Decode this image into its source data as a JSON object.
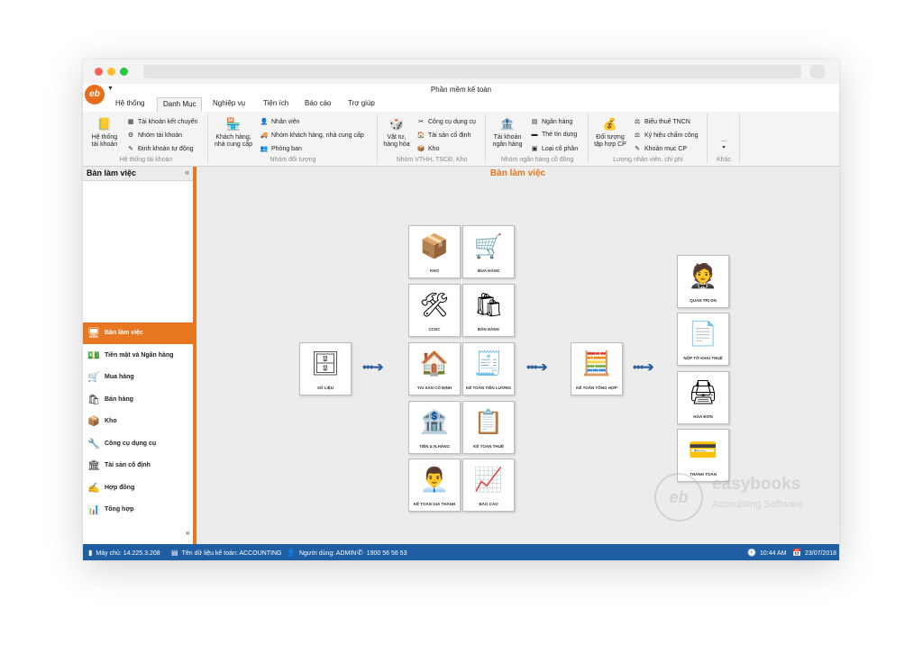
{
  "window": {
    "title": "Phần mềm kế toán",
    "logo_text": "eb"
  },
  "menu": [
    {
      "label": "Hệ thống",
      "active": false
    },
    {
      "label": "Danh Mục",
      "active": true
    },
    {
      "label": "Nghiệp vụ",
      "active": false
    },
    {
      "label": "Tiện ích",
      "active": false
    },
    {
      "label": "Báo cáo",
      "active": false
    },
    {
      "label": "Trợ giúp",
      "active": false
    }
  ],
  "ribbon": {
    "groups": [
      {
        "label": "Hệ thống tài khoản",
        "big": [
          {
            "line1": "Hệ thống",
            "line2": "tài khoản",
            "icon": "account-system-icon"
          }
        ],
        "small": [
          {
            "label": "Tài khoản kết chuyển",
            "icon": "transfer-account-icon"
          },
          {
            "label": "Nhóm tài khoản",
            "icon": "account-group-icon"
          },
          {
            "label": "Định khoản tự động",
            "icon": "auto-entry-icon"
          }
        ]
      },
      {
        "label": "Nhóm đối tượng",
        "big": [
          {
            "line1": "Khách hàng,",
            "line2": "nhà cung cấp",
            "icon": "customer-supplier-icon"
          }
        ],
        "small": [
          {
            "label": "Nhân viên",
            "icon": "employee-icon"
          },
          {
            "label": "Nhóm khách hàng, nhà cung cấp",
            "icon": "customer-group-icon"
          },
          {
            "label": "Phòng ban",
            "icon": "department-icon"
          }
        ]
      },
      {
        "label": "Nhóm VTHH, TSCĐ, Kho",
        "big": [
          {
            "line1": "Vật tư,",
            "line2": "hàng hóa",
            "icon": "goods-icon"
          }
        ],
        "small": [
          {
            "label": "Công cụ dụng cụ",
            "icon": "tools-icon"
          },
          {
            "label": "Tài sản cố định",
            "icon": "fixed-asset-icon"
          },
          {
            "label": "Kho",
            "icon": "warehouse-icon"
          }
        ]
      },
      {
        "label": "Nhóm ngân hàng cổ đông",
        "big": [
          {
            "line1": "Tài khoản",
            "line2": "ngân hàng",
            "icon": "bank-account-icon"
          }
        ],
        "small": [
          {
            "label": "Ngân hàng",
            "icon": "bank-icon"
          },
          {
            "label": "Thẻ tín dụng",
            "icon": "credit-card-icon"
          },
          {
            "label": "Loại cổ phần",
            "icon": "share-type-icon"
          }
        ]
      },
      {
        "label": "Lương nhân viên, chi phí",
        "big": [
          {
            "line1": "Đối tượng",
            "line2": "tập hợp CP",
            "icon": "cost-object-icon"
          }
        ],
        "small": [
          {
            "label": "Biểu thuế TNCN",
            "icon": "tax-table-icon"
          },
          {
            "label": "Ký hiệu chấm công",
            "icon": "timesheet-icon"
          },
          {
            "label": "Khoản mục CP",
            "icon": "cost-item-icon"
          }
        ]
      },
      {
        "label": "Khác",
        "big": [
          {
            "line1": "...",
            "line2": "",
            "icon": "more-icon"
          }
        ],
        "small": []
      }
    ]
  },
  "sidebar": {
    "title": "Bàn làm việc",
    "items": [
      {
        "label": "Bàn làm việc",
        "active": true,
        "icon": "desktop-icon"
      },
      {
        "label": "Tiền mặt và Ngân hàng",
        "active": false,
        "icon": "cash-bank-icon"
      },
      {
        "label": "Mua hàng",
        "active": false,
        "icon": "purchase-icon"
      },
      {
        "label": "Bán hàng",
        "active": false,
        "icon": "sales-icon"
      },
      {
        "label": "Kho",
        "active": false,
        "icon": "warehouse-icon"
      },
      {
        "label": "Công cụ dụng cụ",
        "active": false,
        "icon": "tools-icon"
      },
      {
        "label": "Tài sản cố định",
        "active": false,
        "icon": "fixed-asset-icon"
      },
      {
        "label": "Hợp đồng",
        "active": false,
        "icon": "contract-icon"
      },
      {
        "label": "Tổng hợp",
        "active": false,
        "icon": "summary-icon"
      }
    ]
  },
  "workspace": {
    "title": "Bàn làm việc",
    "tiles": {
      "so_lieu": "SỐ LIỆU",
      "kho": "KHO",
      "mua_hang": "MUA HÀNG",
      "ccdc": "CCDC",
      "ban_hang": "BÁN HÀNG",
      "tai_san": "TÀI SẢN CỐ ĐỊNH",
      "tien_luong": "KẾ TOÁN TIỀN LƯƠNG",
      "tien_ngan_hang": "TIỀN & N.HÀNG",
      "ke_toan_thue": "KẾ TOÁN THUẾ",
      "gia_thanh": "KẾ TOÁN GIÁ THÀNH",
      "bao_cao": "BÁO CÁO",
      "tong_hop": "KẾ TOÁN TỔNG HỢP",
      "quan_tri": "QUẢN TRỊ DN",
      "to_khai": "NỘP TỜ KHAI THUẾ",
      "hoa_don": "HÓA ĐƠN",
      "thanh_toan": "THANH TOÁN"
    }
  },
  "watermark": {
    "logo_text": "eb",
    "brand": "easybooks",
    "tagline": "Accounting Software"
  },
  "status": {
    "server": "Máy chủ: 14.225.3.208",
    "database": "Tên dữ liệu kế toán: ACCOUNTING",
    "user": "Người dùng: ADMIN",
    "phone": "1900 56 56 53",
    "time": "10:44 AM",
    "date": "23/07/2018"
  },
  "colors": {
    "accent": "#e87722",
    "statusbar": "#1f5ea3",
    "arrow": "#2b5f9e"
  }
}
